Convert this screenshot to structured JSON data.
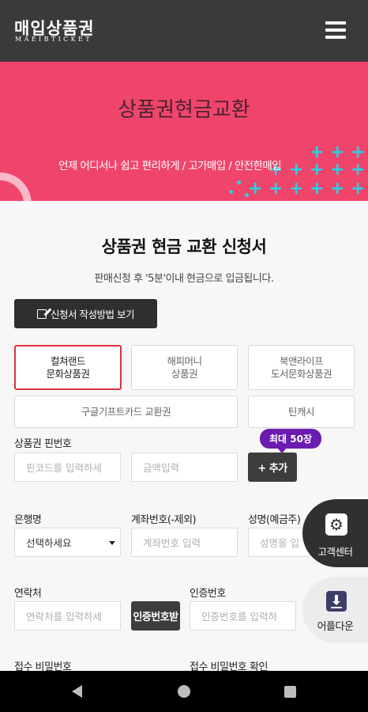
{
  "header": {
    "logo_main": "매입상품권",
    "logo_sub": "MAEIBTICKET"
  },
  "hero": {
    "title": "상품권현금교환",
    "subtitle": "언제 어디서나 쉽고 편리하게 / 고가매입 / 안전한매입"
  },
  "form": {
    "title": "상품권 현금 교환 신청서",
    "subtitle": "판매신청 후 '5분'이내 현금으로 입금됩니다.",
    "guide_button": "신청서 작성방법 보기",
    "voucher_types": [
      {
        "line1": "컬쳐랜드",
        "line2": "문화상품권",
        "selected": true
      },
      {
        "line1": "해피머니",
        "line2": "상품권",
        "selected": false
      },
      {
        "line1": "북앤라이프",
        "line2": "도서문화상품권",
        "selected": false
      },
      {
        "line1": "구글기프트카드 교환권",
        "line2": "",
        "selected": false
      },
      {
        "line1": "틴캐시",
        "line2": "",
        "selected": false
      }
    ],
    "pin_label": "상품권 핀번호",
    "max_badge": "최대 50장",
    "pin_placeholder": "핀코드를 입력하세",
    "amount_placeholder": "금액입력",
    "add_button": "+ 추가",
    "bank_label": "은행명",
    "bank_select": "선택하세요",
    "account_label": "계좌번호(-제외)",
    "account_placeholder": "계좌번호 입력",
    "name_label": "성명(예금주)",
    "name_placeholder": "성명을 입",
    "contact_label": "연락처",
    "contact_placeholder": "연락처를 입력하세",
    "auth_button": "인증번호받",
    "auth_label": "인증번호",
    "auth_placeholder": "인증번호를 입력하",
    "receipt_pw_label": "접수 비밀번호",
    "receipt_pw_confirm_label": "접수 비밀번호 확인"
  },
  "floating": {
    "customer_center": "고객센터",
    "app_download": "어플다운"
  },
  "icons": {
    "menu": "hamburger-menu-icon",
    "edit": "edit-icon",
    "gear": "gear-icon",
    "download": "download-icon"
  },
  "colors": {
    "header_bg": "#3a3a3a",
    "hero_bg": "#f0456b",
    "accent_cyan": "#24d3e6",
    "selected_border": "#e0313f",
    "badge_purple": "#6a1bb0"
  }
}
